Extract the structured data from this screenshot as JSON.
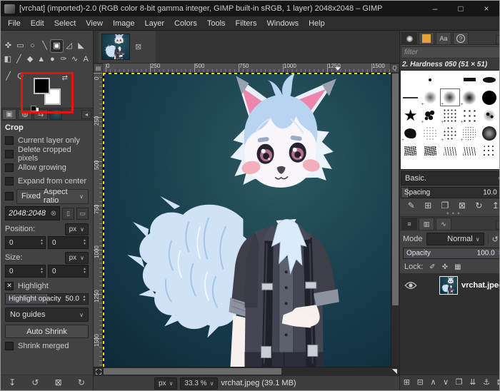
{
  "window": {
    "title": "[vrchat] (imported)-2.0 (RGB color 8-bit gamma integer, GIMP built-in sRGB, 1 layer) 2048x2048 – GIMP",
    "minimize": "–",
    "maximize": "□",
    "close": "×"
  },
  "menu": {
    "items": [
      "File",
      "Edit",
      "Select",
      "View",
      "Image",
      "Layer",
      "Colors",
      "Tools",
      "Filters",
      "Windows",
      "Help"
    ]
  },
  "toolbox": {
    "rows": [
      [
        {
          "name": "move-tool-icon",
          "glyph": "✜"
        },
        {
          "name": "rectangle-select-tool-icon",
          "glyph": "▭"
        },
        {
          "name": "free-select-tool-icon",
          "glyph": "○"
        },
        {
          "name": "measure-tool-icon",
          "glyph": "╲"
        },
        {
          "name": "crop-tool-icon",
          "glyph": "▣",
          "active": true
        },
        {
          "name": "unified-transform-tool-icon",
          "glyph": "◿"
        },
        {
          "name": "gradient-tool-icon",
          "glyph": "◣"
        }
      ],
      [
        {
          "name": "bucket-fill-tool-icon",
          "glyph": "◧"
        },
        {
          "name": "paintbrush-tool-icon",
          "glyph": "╱"
        },
        {
          "name": "eraser-tool-icon",
          "glyph": "◆"
        },
        {
          "name": "airbrush-tool-icon",
          "glyph": "▲"
        },
        {
          "name": "clone-tool-icon",
          "glyph": "●"
        },
        {
          "name": "smudge-tool-icon",
          "glyph": "✑"
        },
        {
          "name": "paths-tool-icon",
          "glyph": "∿"
        },
        {
          "name": "text-tool-icon",
          "glyph": "A"
        }
      ],
      [
        {
          "name": "ink-tool-icon",
          "glyph": "╱"
        },
        {
          "name": "zoom-tool-icon",
          "glyph": "Q"
        }
      ]
    ]
  },
  "color_area": {
    "foreground": "#000000",
    "background": "#ffffff",
    "annotation_color": "#de1717"
  },
  "left_dock_tabs": {
    "items": [
      {
        "name": "tab-tool-options",
        "glyph": "▣",
        "active": true
      },
      {
        "name": "tab-device-status",
        "glyph": "◍"
      },
      {
        "name": "tab-undo-history",
        "glyph": "⇆"
      }
    ]
  },
  "tool_options": {
    "title": "Crop",
    "checkboxes": [
      {
        "label": "Current layer only",
        "checked": false
      },
      {
        "label": "Delete cropped pixels",
        "checked": false
      },
      {
        "label": "Allow growing",
        "checked": false
      },
      {
        "label": "Expand from center",
        "checked": false
      }
    ],
    "fixed": {
      "checked": false,
      "label": "Fixed",
      "mode": "Aspect ratio"
    },
    "aspect_value": "2048:2048",
    "position": {
      "label": "Position:",
      "unit": "px",
      "x": "0",
      "y": "0"
    },
    "size": {
      "label": "Size:",
      "unit": "px",
      "x": "0",
      "y": "0"
    },
    "highlight": {
      "label": "Highlight",
      "checked": true
    },
    "highlight_opacity": {
      "label": "Highlight opacity",
      "value": "50.0",
      "percent": 50
    },
    "guides": "No guides",
    "auto_shrink_label": "Auto Shrink",
    "shrink_merged": {
      "label": "Shrink merged",
      "checked": false
    },
    "footer_icons": [
      {
        "name": "save-tool-preset-icon",
        "glyph": "↧"
      },
      {
        "name": "restore-tool-preset-icon",
        "glyph": "↺"
      },
      {
        "name": "delete-tool-preset-icon",
        "glyph": "⊠"
      },
      {
        "name": "reset-tool-options-icon",
        "glyph": "↻"
      }
    ]
  },
  "canvas": {
    "ruler_h": [
      "0",
      "250",
      "500",
      "750",
      "1000",
      "1250",
      "1500"
    ],
    "ruler_v": [
      "0",
      "250",
      "500",
      "750",
      "1000",
      "1250",
      "1500"
    ],
    "statusbar": {
      "unit": "px",
      "zoom_level": "33.3 %",
      "status_text": "vrchat.jpeg (39.1 MB)"
    }
  },
  "brushes": {
    "filter_placeholder": "filter",
    "selected_brush_label": "2. Hardness 050 (51 × 51)",
    "fonts_tab_label": "Aa",
    "help_tab_label": "?",
    "group_label": "Basic.",
    "spacing": {
      "label": "Spacing",
      "value": "10.0",
      "percent": 6
    },
    "actions": [
      {
        "name": "edit-brush-icon",
        "glyph": "✎"
      },
      {
        "name": "new-brush-icon",
        "glyph": "⊞"
      },
      {
        "name": "duplicate-brush-icon",
        "glyph": "❐"
      },
      {
        "name": "delete-brush-icon",
        "glyph": "⊠"
      },
      {
        "name": "refresh-brushes-icon",
        "glyph": "↻"
      },
      {
        "name": "open-brush-as-image-icon",
        "glyph": "↥"
      }
    ],
    "grid": [
      {
        "type": "blank"
      },
      {
        "type": "dot"
      },
      {
        "type": "blank"
      },
      {
        "type": "bar"
      },
      {
        "type": "ellipse"
      },
      {
        "type": "line"
      },
      {
        "type": "soft",
        "marker": "blue"
      },
      {
        "type": "soft-selected",
        "marker": "blue"
      },
      {
        "type": "soft-dark",
        "marker": "blue"
      },
      {
        "type": "circle"
      },
      {
        "type": "star"
      },
      {
        "type": "splat",
        "marker": "red"
      },
      {
        "type": "splat2",
        "marker": "red"
      },
      {
        "type": "splat3",
        "marker": "red"
      },
      {
        "type": "splat4"
      },
      {
        "type": "blob",
        "marker": "red"
      },
      {
        "type": "texture"
      },
      {
        "type": "texture2",
        "marker": "red"
      },
      {
        "type": "texture3",
        "marker": "red"
      },
      {
        "type": "vignette"
      },
      {
        "type": "chalk"
      },
      {
        "type": "chalk2"
      },
      {
        "type": "scribble"
      },
      {
        "type": "scribble2"
      },
      {
        "type": "texture4"
      }
    ]
  },
  "layers": {
    "dock_tabs": [
      {
        "name": "tab-layers",
        "glyph": "≡",
        "active": true
      },
      {
        "name": "tab-channels",
        "glyph": "▥"
      },
      {
        "name": "tab-paths",
        "glyph": "∿"
      }
    ],
    "mode": {
      "label": "Mode",
      "value": "Normal"
    },
    "opacity": {
      "label": "Opacity",
      "value": "100.0",
      "percent": 100
    },
    "lock_label": "Lock:",
    "rows": [
      {
        "name": "vrchat.jpeg",
        "visible": true
      }
    ],
    "footer_icons": [
      {
        "name": "new-layer-icon",
        "glyph": "⊞"
      },
      {
        "name": "new-layer-group-icon",
        "glyph": "⊟"
      },
      {
        "name": "raise-layer-icon",
        "glyph": "∧"
      },
      {
        "name": "lower-layer-icon",
        "glyph": "∨"
      },
      {
        "name": "duplicate-layer-icon",
        "glyph": "❐"
      },
      {
        "name": "merge-down-icon",
        "glyph": "⇊"
      },
      {
        "name": "anchor-layer-icon",
        "glyph": "⚓"
      },
      {
        "name": "delete-layer-icon",
        "glyph": "⊠"
      }
    ]
  }
}
